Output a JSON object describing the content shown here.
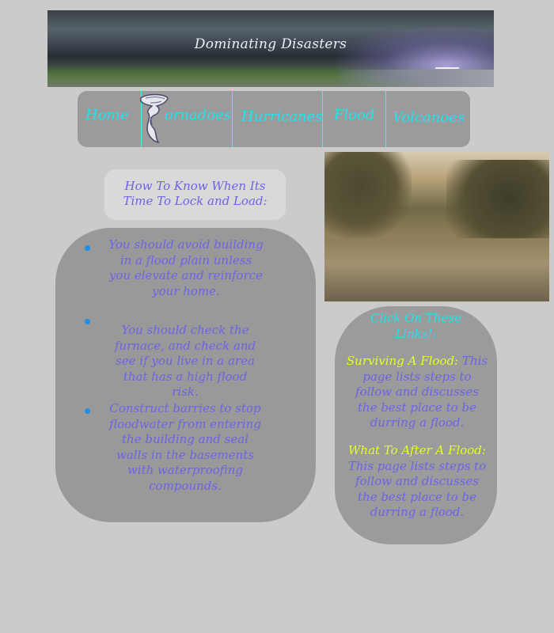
{
  "banner": {
    "title": "Dominating Disasters"
  },
  "nav": {
    "home": "Home",
    "tornadoes": "ornadoes",
    "hurricanes": "Hurricanes",
    "flood": "Flood",
    "volcanoes": "Volcanoes",
    "tornado_icon": "tornado-icon"
  },
  "heading": {
    "line1": "How To Know When Its",
    "line2": "Time To Lock and Load:"
  },
  "list": {
    "items": [
      "You should avoid building in a flood plain unless you elevate and reinforce your home.",
      "You should check the furnace, and check and see if you live in a area that has a high flood risk.",
      "Construct barries to stop floodwater from entering the building and seal walls in the basements with waterproofing compounds."
    ]
  },
  "links": {
    "title": "Click On These Links!:",
    "items": [
      {
        "link": "Surviving A Flood:",
        "desc": "This page lists steps to follow and discusses the best place to be durring a flood."
      },
      {
        "link": "What To After A Flood:",
        "desc": "This page lists steps to follow and discusses the best place to be durring a flood."
      }
    ]
  },
  "colors": {
    "background": "#cbcbcb",
    "nav_text": "#1fe3ee",
    "body_text": "#6c63e6",
    "link_text": "#e6ff22",
    "bullet": "#1f8fe6"
  }
}
